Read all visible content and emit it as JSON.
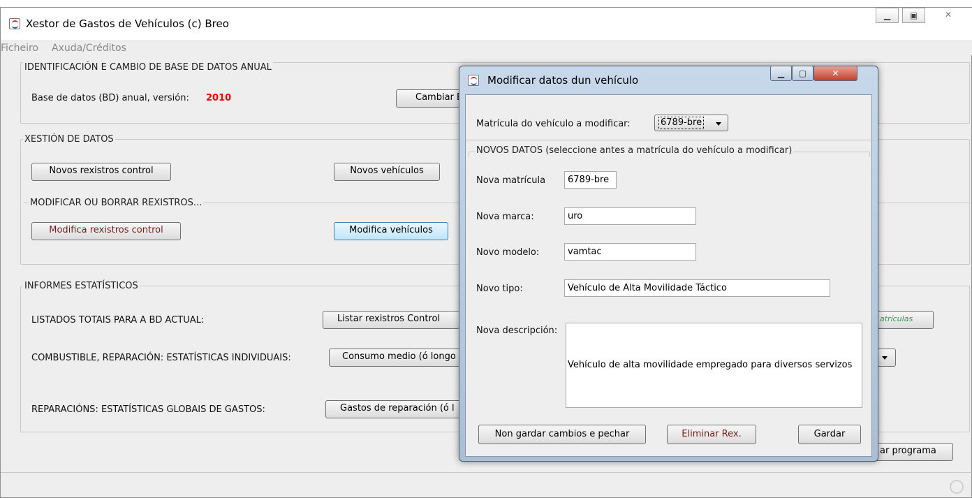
{
  "window": {
    "title": "Xestor de Gastos de Vehículos (c) Breo"
  },
  "menu": {
    "file": "Ficheiro",
    "help": "Axuda/Créditos"
  },
  "section_db": {
    "title": "IDENTIFICACIÓN E CAMBIO DE BASE DE DATOS ANUAL",
    "label": "Base de datos (BD) anual, versión:",
    "year": "2010",
    "change_button": "Cambiar BD"
  },
  "section_data": {
    "title": "XESTIÓN DE DATOS",
    "new_records_button": "Novos rexistros control",
    "new_vehicles_button": "Novos vehículos"
  },
  "section_modify": {
    "title": "MODIFICAR OU BORRAR REXISTROS...",
    "modify_records_button": "Modifica rexistros control",
    "modify_vehicles_button": "Modifica vehículos"
  },
  "section_reports": {
    "title": "INFORMES ESTATÍSTICOS",
    "totals_label": "LISTADOS TOTAIS PARA A BD ACTUAL:",
    "list_control_button": "Listar rexistros Control",
    "list_plates_button": "atrículas",
    "fuel_label": "COMBUSTIBLE, REPARACIÓN: ESTATÍSTICAS INDIVIDUAIS:",
    "fuel_button": "Consumo medio (ó longo",
    "repairs_label": "REPARACIÓNS: ESTATÍSTICAS GLOBAIS DE GASTOS:",
    "repairs_button": "Gastos de reparación (ó l"
  },
  "exit_button": "ar programa",
  "dialog": {
    "title": "Modificar datos dun vehículo",
    "plate_select_label": "Matrícula do vehículo a modificar:",
    "plate_selected": "6789-bre",
    "new_data_title": "NOVOS DATOS (seleccione antes a matrícula do vehículo a modificar)",
    "plate_label": "Nova matrícula",
    "plate_value": "6789-bre",
    "brand_label": "Nova marca:",
    "brand_value": "uro",
    "model_label": "Novo modelo:",
    "model_value": "vamtac",
    "type_label": "Novo tipo:",
    "type_value": "Vehículo de Alta Movilidade Táctico",
    "desc_label": "Nova descripción:",
    "desc_value": "Vehículo de alta movilidade empregado para diversos servizos",
    "cancel_button": "Non gardar cambios e pechar",
    "delete_button": "Eliminar Rex.",
    "save_button": "Gardar"
  },
  "colors": {
    "year": "#ff0000",
    "plates_button_text": "#2e9a5a",
    "dialog_frame": "#b4c8de",
    "focus_button": "#bee6fd"
  }
}
